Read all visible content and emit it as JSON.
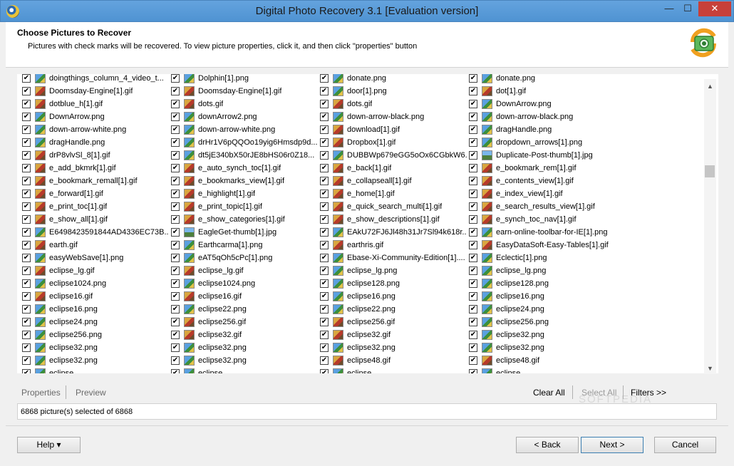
{
  "window": {
    "title": "Digital Photo Recovery 3.1 [Evaluation version]",
    "minimize_glyph": "—",
    "maximize_glyph": "☐",
    "close_glyph": "✕"
  },
  "header": {
    "title": "Choose Pictures to Recover",
    "subtitle": "Pictures with check marks will be recovered. To view picture properties, click it, and then click \"properties\" button",
    "logo_icon": "camera-recover-icon"
  },
  "pictures": {
    "columns": [
      [
        "doingthings_column_4_video_t...",
        "Doomsday-Engine[1].gif",
        "dotblue_h[1].gif",
        "DownArrow.png",
        "down-arrow-white.png",
        "dragHandle.png",
        "drP8vlvSl_8[1].gif",
        "e_add_bkmrk[1].gif",
        "e_bookmark_remall[1].gif",
        "e_forward[1].gif",
        "e_print_toc[1].gif",
        "e_show_all[1].gif",
        "E6498423591844AD4336EC73B...",
        "earth.gif",
        "easyWebSave[1].png",
        "eclipse_lg.gif",
        "eclipse1024.png",
        "eclipse16.gif",
        "eclipse16.png",
        "eclipse24.png",
        "eclipse256.png",
        "eclipse32.png",
        "eclipse32.png",
        "eclipse..."
      ],
      [
        "Dolphin[1].png",
        "Doomsday-Engine[1].gif",
        "dots.gif",
        "downArrow2.png",
        "down-arrow-white.png",
        "drHr1V6pQQOo19yig6Hmsdp9d...",
        "dt5jE340bX50rJE8bHS06r0Z18...",
        "e_auto_synch_toc[1].gif",
        "e_bookmarks_view[1].gif",
        "e_highlight[1].gif",
        "e_print_topic[1].gif",
        "e_show_categories[1].gif",
        "EagleGet-thumb[1].jpg",
        "Earthcarma[1].png",
        "eAT5qOh5cPc[1].png",
        "eclipse_lg.gif",
        "eclipse1024.png",
        "eclipse16.gif",
        "eclipse22.png",
        "eclipse256.gif",
        "eclipse32.gif",
        "eclipse32.png",
        "eclipse32.png",
        "eclipse..."
      ],
      [
        "donate.png",
        "door[1].png",
        "dots.gif",
        "down-arrow-black.png",
        "download[1].gif",
        "Dropbox[1].gif",
        "DUBBWp679eGG5oOx6CGbkW6...",
        "e_back[1].gif",
        "e_collapseall[1].gif",
        "e_home[1].gif",
        "e_quick_search_multi[1].gif",
        "e_show_descriptions[1].gif",
        "EAkU72FJ6Jl48h31Jr7Sl94k618r...",
        "earthris.gif",
        "Ebase-Xi-Community-Edition[1]....",
        "eclipse_lg.png",
        "eclipse128.png",
        "eclipse16.png",
        "eclipse22.png",
        "eclipse256.gif",
        "eclipse32.gif",
        "eclipse32.png",
        "eclipse48.gif",
        "eclipse..."
      ],
      [
        "donate.png",
        "dot[1].gif",
        "DownArrow.png",
        "down-arrow-black.png",
        "dragHandle.png",
        "dropdown_arrows[1].png",
        "Duplicate-Post-thumb[1].jpg",
        "e_bookmark_rem[1].gif",
        "e_contents_view[1].gif",
        "e_index_view[1].gif",
        "e_search_results_view[1].gif",
        "e_synch_toc_nav[1].gif",
        "earn-online-toolbar-for-IE[1].png",
        "EasyDataSoft-Easy-Tables[1].gif",
        "Eclectic[1].png",
        "eclipse_lg.png",
        "eclipse128.png",
        "eclipse16.png",
        "eclipse24.png",
        "eclipse256.png",
        "eclipse32.png",
        "eclipse32.png",
        "eclipse48.gif",
        "eclipse..."
      ]
    ],
    "check_glyph": "✔"
  },
  "tabs": {
    "properties": "Properties",
    "preview": "Preview"
  },
  "actions": {
    "clear_all": "Clear All",
    "select_all": "Select All",
    "filters": "Filters >>"
  },
  "status": {
    "text": "6868 picture(s) selected of 6868"
  },
  "buttons": {
    "help": "Help ▾",
    "back": "< Back",
    "next": "Next >",
    "cancel": "Cancel"
  },
  "scrollbar": {
    "up_glyph": "▲",
    "down_glyph": "▼"
  },
  "watermark": "SOFTPEDIA"
}
